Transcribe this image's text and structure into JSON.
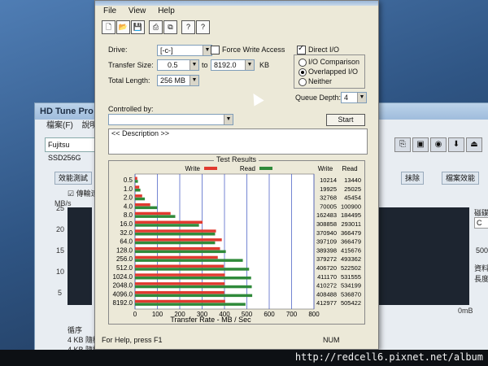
{
  "background_window": {
    "title": "HD Tune Pro",
    "menu": [
      "檔案(F)",
      "說明"
    ],
    "drive": "Fujitsu SSD256G",
    "tabs": [
      "效能測試",
      "抹除",
      "檔案效能"
    ],
    "checkbox_label": "傳輸速",
    "left_axis_unit": "MB/s",
    "left_ticks": [
      "25",
      "20",
      "15",
      "10",
      "5"
    ],
    "right_axis_zero": "0mB",
    "right_labels": [
      "磁碟",
      "500",
      "資料長度"
    ],
    "right_field_value": "C",
    "bottom_text": [
      "循序",
      "4 KB 隨機",
      "4 KB 隨機"
    ]
  },
  "dialog": {
    "menu": [
      "File",
      "View",
      "Help"
    ],
    "toolbar_icons": [
      "new-icon",
      "open-icon",
      "save-icon",
      "print-icon",
      "copy-icon",
      "about-icon",
      "help-icon"
    ],
    "drive_label": "Drive:",
    "drive_value": "[-c-]",
    "force_write_label": "Force Write Access",
    "transfer_size_label": "Transfer Size:",
    "transfer_from": "0.5",
    "transfer_to_word": "to",
    "transfer_to": "8192.0",
    "transfer_unit": "KB",
    "total_length_label": "Total Length:",
    "total_length_value": "256 MB",
    "direct_io_label": "Direct I/O",
    "io_comparison_label": "I/O Comparison",
    "overlapped_io_label": "Overlapped I/O",
    "neither_label": "Neither",
    "queue_depth_label": "Queue Depth:",
    "queue_depth_value": "4",
    "controlled_by_label": "Controlled by:",
    "start_label": "Start",
    "description_text": "<< Description >>",
    "results_title": "Test Results",
    "legend_write": "Write",
    "legend_read": "Read",
    "col_write": "Write",
    "col_read": "Read",
    "x_axis_label": "Transfer Rate - MB / Sec",
    "status_text": "For Help, press F1",
    "status_num": "NUM"
  },
  "url_watermark": "http://redcell6.pixnet.net/album",
  "colors": {
    "write": "#e03a2f",
    "read": "#2f8a3a",
    "grid": "#3a52c0"
  },
  "chart_data": {
    "type": "bar",
    "title": "Test Results",
    "xlabel": "Transfer Rate - MB / Sec",
    "xlim": [
      0,
      800
    ],
    "x_ticks": [
      "0",
      "100",
      "200",
      "300",
      "400",
      "500",
      "600",
      "700",
      "800"
    ],
    "categories": [
      "0.5",
      "1.0",
      "2.0",
      "4.0",
      "8.0",
      "16.0",
      "32.0",
      "64.0",
      "128.0",
      "256.0",
      "512.0",
      "1024.0",
      "2048.0",
      "4096.0",
      "8192.0"
    ],
    "write_kb": [
      "10214",
      "19925",
      "32768",
      "70005",
      "162483",
      "308858",
      "370940",
      "397109",
      "389398",
      "379272",
      "406720",
      "411170",
      "410272",
      "408488",
      "412977"
    ],
    "read_kb": [
      "13440",
      "25025",
      "45454",
      "100900",
      "184495",
      "293011",
      "366479",
      "366479",
      "415676",
      "493362",
      "522502",
      "531555",
      "534199",
      "536870",
      "505422"
    ],
    "series": [
      {
        "name": "Write",
        "values": [
          10,
          19,
          32,
          68,
          159,
          302,
          362,
          388,
          380,
          370,
          397,
          402,
          401,
          399,
          403
        ]
      },
      {
        "name": "Read",
        "values": [
          13,
          24,
          44,
          99,
          180,
          286,
          358,
          358,
          406,
          482,
          510,
          519,
          522,
          524,
          494
        ]
      }
    ]
  }
}
